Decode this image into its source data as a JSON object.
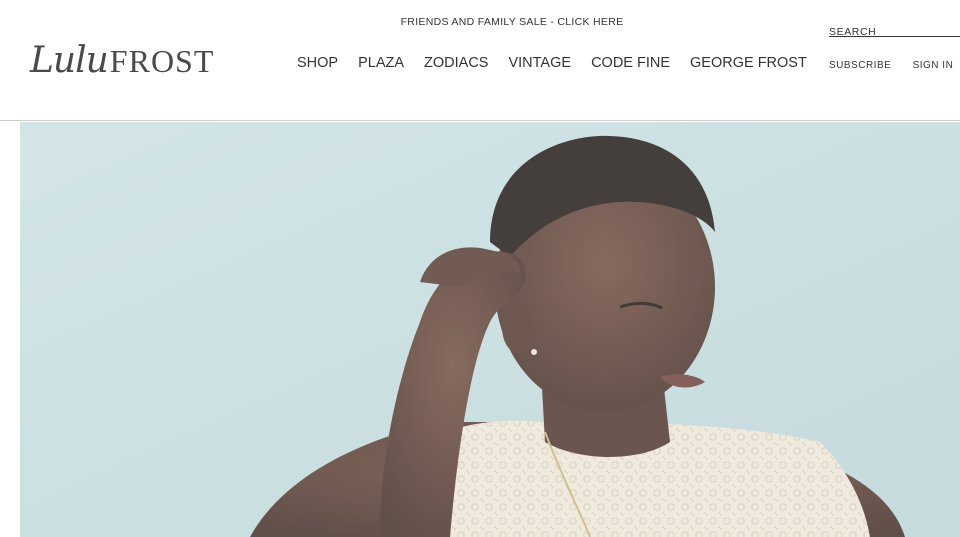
{
  "promo": {
    "text": "FRIENDS AND FAMILY SALE - CLICK HERE"
  },
  "logo": {
    "script": "Lulu",
    "caps": "FROST"
  },
  "nav": {
    "items": [
      {
        "label": "SHOP"
      },
      {
        "label": "PLAZA"
      },
      {
        "label": "ZODIACS"
      },
      {
        "label": "VINTAGE"
      },
      {
        "label": "CODE FINE"
      },
      {
        "label": "GEORGE FROST"
      }
    ]
  },
  "search": {
    "placeholder": "SEARCH"
  },
  "account": {
    "subscribe": "SUBSCRIBE",
    "sign_in": "SIGN IN"
  },
  "colors": {
    "hero_background": "#c4dbdd",
    "text": "#333333",
    "divider": "#cfcfcf"
  }
}
